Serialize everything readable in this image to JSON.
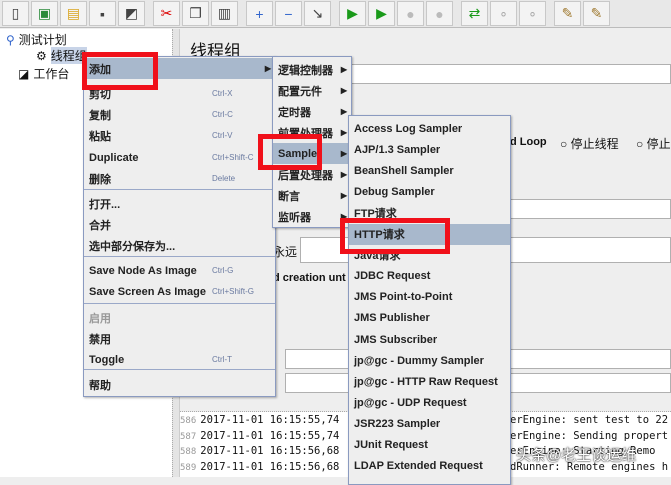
{
  "toolbar": {
    "icons": [
      "new-icon",
      "templates-icon",
      "open-icon",
      "save-icon",
      "save-as-icon",
      "cut-icon",
      "copy-icon",
      "paste-icon",
      "expand-icon",
      "collapse-icon",
      "toggle-icon",
      "start-icon",
      "start-no-pause-icon",
      "stop-icon",
      "shutdown-icon",
      "remote-start-icon",
      "remote-stop-icon",
      "remote-shutdown-icon",
      "clear-icon",
      "clear-all-icon"
    ]
  },
  "tree": {
    "test_plan": "测试计划",
    "thread_group": "线程组",
    "workbench": "工作台"
  },
  "main": {
    "title": "线程组",
    "loop_action": "d Loop",
    "stop_thread": "停止线程",
    "stop_test": "停止",
    "forever": "永远",
    "delay_creation": "d creation unt"
  },
  "context_menu": {
    "items": [
      {
        "label": "添加",
        "shortcut": ""
      },
      {
        "label": "剪切",
        "shortcut": "Ctrl-X"
      },
      {
        "label": "复制",
        "shortcut": "Ctrl-C"
      },
      {
        "label": "粘贴",
        "shortcut": "Ctrl-V"
      },
      {
        "label": "Duplicate",
        "shortcut": "Ctrl+Shift-C"
      },
      {
        "label": "删除",
        "shortcut": "Delete"
      },
      {
        "label": "打开...",
        "shortcut": ""
      },
      {
        "label": "合并",
        "shortcut": ""
      },
      {
        "label": "选中部分保存为...",
        "shortcut": ""
      },
      {
        "label": "Save Node As Image",
        "shortcut": "Ctrl-G"
      },
      {
        "label": "Save Screen As Image",
        "shortcut": "Ctrl+Shift-G"
      },
      {
        "label": "启用",
        "shortcut": ""
      },
      {
        "label": "禁用",
        "shortcut": ""
      },
      {
        "label": "Toggle",
        "shortcut": "Ctrl-T"
      },
      {
        "label": "帮助",
        "shortcut": ""
      }
    ]
  },
  "add_submenu": {
    "items": [
      "逻辑控制器",
      "配置元件",
      "定时器",
      "前置处理器",
      "Sampler",
      "后置处理器",
      "断言",
      "监听器"
    ]
  },
  "sampler_submenu": {
    "items": [
      "Access Log Sampler",
      "AJP/1.3 Sampler",
      "BeanShell Sampler",
      "Debug Sampler",
      "FTP请求",
      "HTTP请求",
      "Java请求",
      "JDBC Request",
      "JMS Point-to-Point",
      "JMS Publisher",
      "JMS Subscriber",
      "jp@gc - Dummy Sampler",
      "jp@gc - HTTP Raw Request",
      "jp@gc - UDP Request",
      "JSR223 Sampler",
      "JUnit Request",
      "LDAP Extended Request"
    ]
  },
  "log": {
    "lines": [
      {
        "n": "586",
        "a": "2017-11-01 16:15:55,74",
        "b": "erEngine: sent test to 22"
      },
      {
        "n": "587",
        "a": "2017-11-01 16:15:55,74",
        "b": "erEngine: Sending propert"
      },
      {
        "n": "588",
        "a": "2017-11-01 16:15:56,68",
        "b": "erEngine: Starting Remo"
      },
      {
        "n": "589",
        "a": "2017-11-01 16:15:56,68",
        "b": "dRunner: Remote engines h"
      }
    ]
  },
  "watermark": "头条@老王谈运维"
}
